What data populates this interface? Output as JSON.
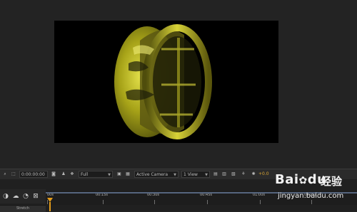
{
  "viewer_toolbar": {
    "timecode": "0:00:00:00",
    "resolution": "Full",
    "view_camera": "Active Camera",
    "view_layout": "1 View",
    "exposure": "+0.0"
  },
  "timeline": {
    "ticks": [
      "00s",
      "00:15s",
      "00:30s",
      "00:45s",
      "01:00s",
      "01:15s"
    ],
    "stretch_label": "Stretch"
  },
  "watermark": {
    "brand": "Bai",
    "brand_suffix": "经验",
    "url": "jingyan.baidu.com"
  },
  "icons": {
    "camera": "snapshot-icon",
    "color": "rgb-channel-icon",
    "grid": "grid-icon",
    "exposure": "exposure-icon"
  },
  "colors": {
    "accent": "#e39c1b",
    "canvas": "#000000",
    "panel": "#232323"
  }
}
